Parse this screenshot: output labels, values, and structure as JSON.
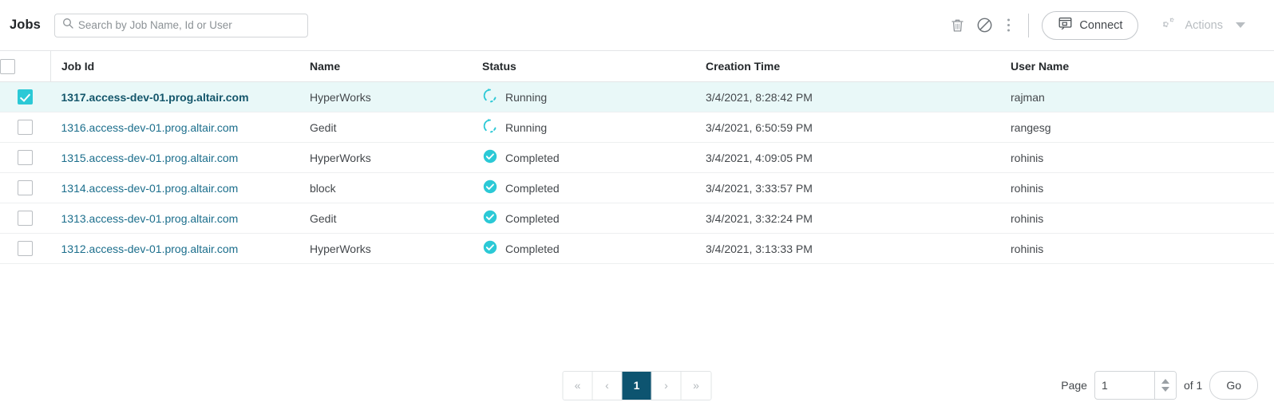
{
  "header": {
    "title": "Jobs",
    "search": {
      "placeholder": "Search by Job Name, Id or User",
      "value": "",
      "icon": "search-icon"
    },
    "tools": [
      {
        "name": "delete-icon",
        "glyph": "trash"
      },
      {
        "name": "cancel-icon",
        "glyph": "prohibition"
      },
      {
        "name": "more-options-icon",
        "glyph": "kebab"
      }
    ],
    "connect_button": {
      "label": "Connect",
      "icon": "remote-desktop-icon"
    },
    "actions_button": {
      "label": "Actions",
      "icon": "gears-icon",
      "disabled": true,
      "caret": "chevron-down-icon"
    }
  },
  "table": {
    "select_all_checked": false,
    "settings_icon": "gear-icon",
    "columns": [
      {
        "key": "jobid",
        "label": "Job Id"
      },
      {
        "key": "name",
        "label": "Name"
      },
      {
        "key": "status",
        "label": "Status"
      },
      {
        "key": "time",
        "label": "Creation Time"
      },
      {
        "key": "user",
        "label": "User Name"
      }
    ],
    "rows": [
      {
        "selected": true,
        "jobid": "1317.access-dev-01.prog.altair.com",
        "name": "HyperWorks",
        "status": "Running",
        "status_icon": "spinner-icon",
        "time": "3/4/2021, 8:28:42 PM",
        "user": "rajman"
      },
      {
        "selected": false,
        "jobid": "1316.access-dev-01.prog.altair.com",
        "name": "Gedit",
        "status": "Running",
        "status_icon": "spinner-icon",
        "time": "3/4/2021, 6:50:59 PM",
        "user": "rangesg"
      },
      {
        "selected": false,
        "jobid": "1315.access-dev-01.prog.altair.com",
        "name": "HyperWorks",
        "status": "Completed",
        "status_icon": "check-circle-icon",
        "time": "3/4/2021, 4:09:05 PM",
        "user": "rohinis"
      },
      {
        "selected": false,
        "jobid": "1314.access-dev-01.prog.altair.com",
        "name": "block",
        "status": "Completed",
        "status_icon": "check-circle-icon",
        "time": "3/4/2021, 3:33:57 PM",
        "user": "rohinis"
      },
      {
        "selected": false,
        "jobid": "1313.access-dev-01.prog.altair.com",
        "name": "Gedit",
        "status": "Completed",
        "status_icon": "check-circle-icon",
        "time": "3/4/2021, 3:32:24 PM",
        "user": "rohinis"
      },
      {
        "selected": false,
        "jobid": "1312.access-dev-01.prog.altair.com",
        "name": "HyperWorks",
        "status": "Completed",
        "status_icon": "check-circle-icon",
        "time": "3/4/2021, 3:13:33 PM",
        "user": "rohinis"
      }
    ]
  },
  "pagination": {
    "first_label": "«",
    "prev_label": "‹",
    "pages": [
      "1"
    ],
    "active_page": "1",
    "next_label": "›",
    "last_label": "»",
    "page_label": "Page",
    "page_value": "1",
    "total_label": "of 1",
    "go_label": "Go"
  },
  "colors": {
    "accent_cyan": "#2bc9d6",
    "selected_row_bg": "#e9f8f8",
    "link_blue": "#1b6e8c",
    "active_page_bg": "#0d5470"
  }
}
